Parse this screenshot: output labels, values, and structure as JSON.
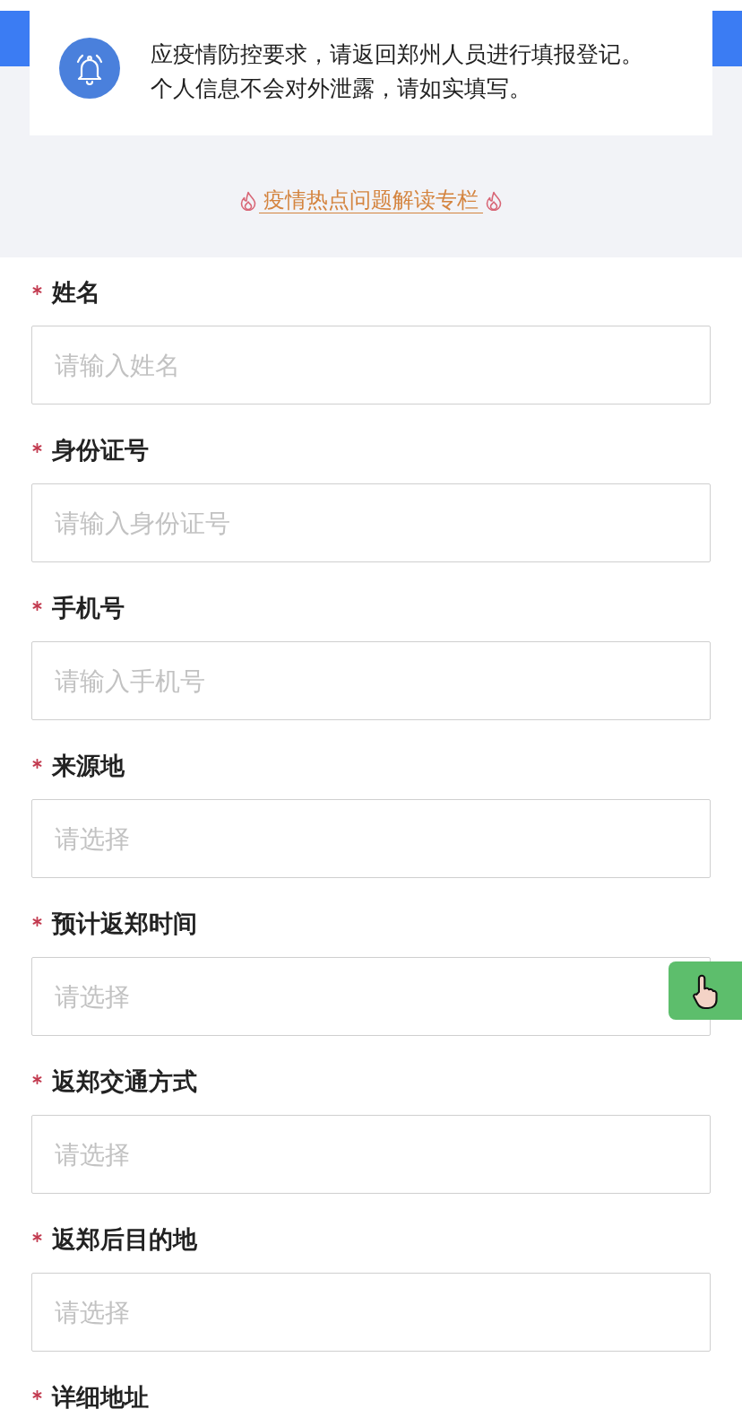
{
  "notice": {
    "lines": [
      "应疫情防控要求，请返回郑州人员进行填报登记。",
      "个人信息不会对外泄露，请如实填写。"
    ]
  },
  "topic_link": {
    "label": "疫情热点问题解读专栏"
  },
  "fields": [
    {
      "label": "姓名",
      "required": true,
      "placeholder": "请输入姓名"
    },
    {
      "label": "身份证号",
      "required": true,
      "placeholder": "请输入身份证号"
    },
    {
      "label": "手机号",
      "required": true,
      "placeholder": "请输入手机号"
    },
    {
      "label": "来源地",
      "required": true,
      "placeholder": "请选择"
    },
    {
      "label": "预计返郑时间",
      "required": true,
      "placeholder": "请选择"
    },
    {
      "label": "返郑交通方式",
      "required": true,
      "placeholder": "请选择"
    },
    {
      "label": "返郑后目的地",
      "required": true,
      "placeholder": "请选择"
    },
    {
      "label": "详细地址",
      "required": true
    }
  ]
}
